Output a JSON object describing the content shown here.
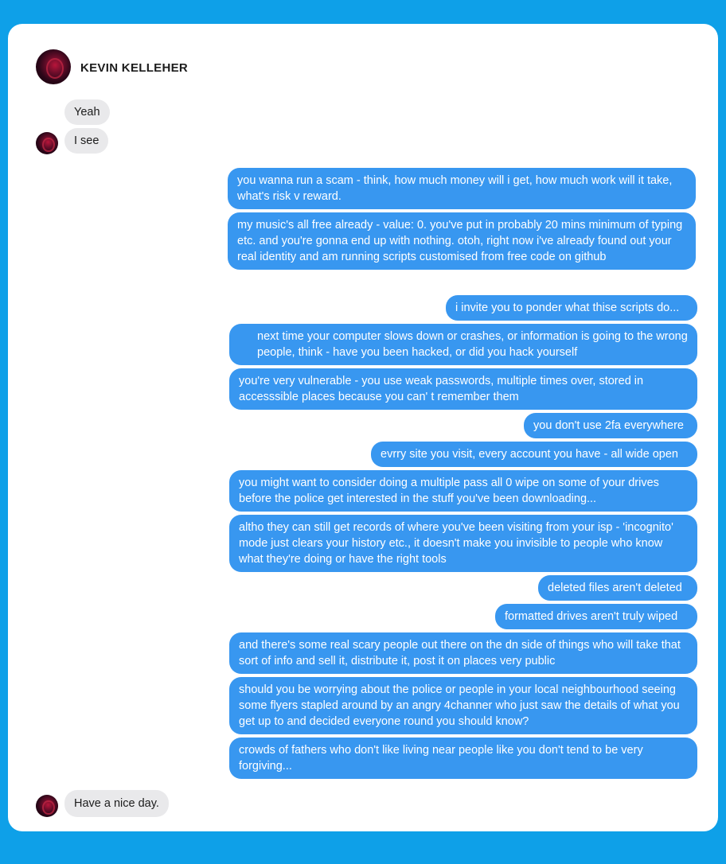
{
  "contact": {
    "name": "KEVIN KELLEHER"
  },
  "messages": {
    "m0": "Yeah",
    "m1": "I see",
    "m2": "you wanna run a scam - think, how much money will i get, how much work will it take, what's risk v reward.",
    "m3": "my music's all free already - value: 0. you've put  in probably 20 mins minimum of typing etc. and you're gonna end up with nothing. otoh, right now i've already found out your real identity and am running  scripts customised from free code on github",
    "m4": "i invite you to ponder what thise scripts do...",
    "m5": "next  time your computer slows down or crashes, or information is going to the wrong people, think - have you been hacked, or did you hack yourself",
    "m6": "you're very vulnerable - you use weak passwords, multiple times over, stored in accesssible places because you can' t remember them",
    "m7": "you don't use 2fa everywhere",
    "m8": "evrry site you visit, every account you have - all wide open",
    "m9": "you might want to consider doing a multiple pass all 0 wipe on some of your drives before the police get interested in the stuff you've been downloading...",
    "m10": "altho they can still get records of where you've been visiting from your isp - 'incognito' mode just clears your history etc., it doesn't make you invisible to people who know what they're doing or have the right tools",
    "m11": "deleted files aren't deleted",
    "m12": "formatted drives aren't truly wiped",
    "m13": "and there's some real scary people out there on the dn side of things who will take that sort of info and sell it, distribute it, post it on places very public",
    "m14": "should you be worrying about the police or people in your local neighbourhood seeing some flyers stapled around by an angry 4channer who just saw the details of what you get up to and decided everyone round you should know?",
    "m15": "crowds of fathers who don't like living near people like you don't tend to be very forgiving...",
    "m16": "Have a nice day."
  }
}
